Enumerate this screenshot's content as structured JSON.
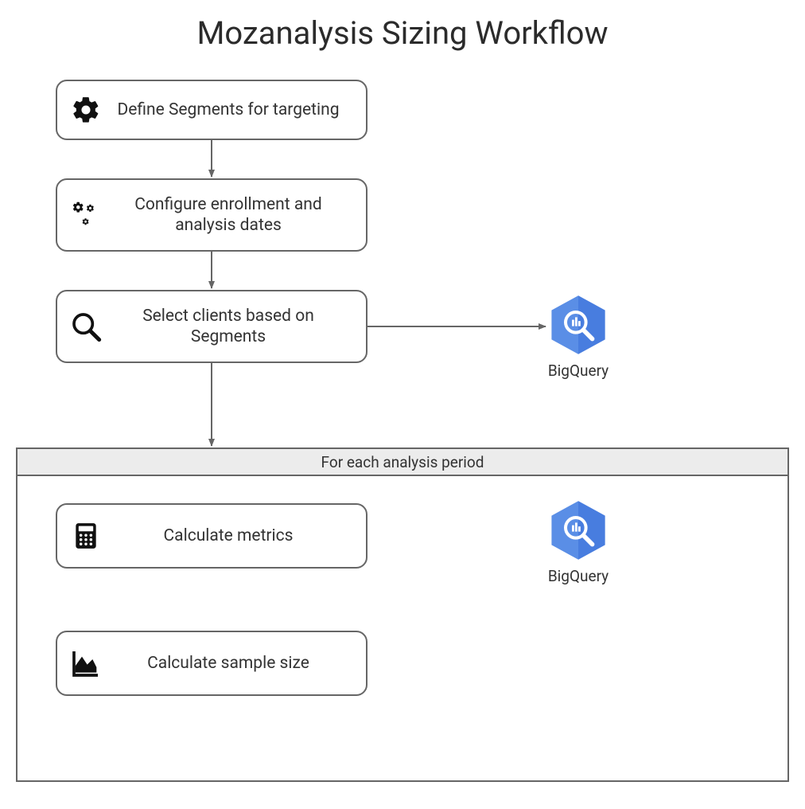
{
  "title": "Mozanalysis Sizing Workflow",
  "nodes": {
    "define_segments": "Define Segments for targeting",
    "configure_enrollment": "Configure enrollment and analysis dates",
    "select_clients": "Select clients based on Segments",
    "calc_metrics": "Calculate metrics",
    "calc_sample_size": "Calculate sample size"
  },
  "container": {
    "header": "For each analysis period"
  },
  "external": {
    "bigquery": "BigQuery"
  }
}
